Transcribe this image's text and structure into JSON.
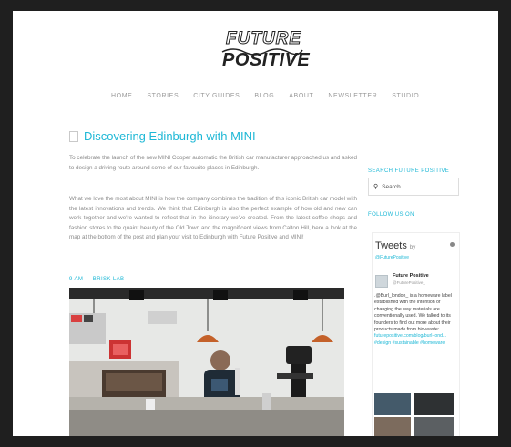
{
  "site": {
    "logo_line1": "FUTURE",
    "logo_line2": "POSITIVE"
  },
  "nav": [
    "HOME",
    "STORIES",
    "CITY GUIDES",
    "BLOG",
    "ABOUT",
    "NEWSLETTER",
    "STUDIO"
  ],
  "post": {
    "title": "Discovering Edinburgh with MINI",
    "para1": "To celebrate the launch of the new MINI Cooper automatic the British car manufacturer approached us and asked to design a driving route around some of our favourite places in Edinburgh.",
    "para2": "What we love the most about MINI is how the company combines the tradition of this iconic British car model with the latest innovations and trends. We think that Edinburgh is also the perfect example of how old and new can work together and we're wanted to reflect that in the itinerary we've created. From the latest coffee shops and fashion stores to the quaint beauty of the Old Town and the magnificent views from Calton Hill, here a look at the map at the bottom of the post and plan your visit to Edinburgh with Future Positive and MINI!",
    "meta": "9 AM — BRISK LAB"
  },
  "sidebar": {
    "search_label": "SEARCH FUTURE POSITIVE",
    "search_placeholder": "Search",
    "follow_label": "FOLLOW US ON",
    "tweets": {
      "title": "Tweets",
      "by": "by",
      "handle_line": "@FuturePositive_",
      "author_name": "Future Positive",
      "author_handle": "@FuturePositive_",
      "text": ".@Burl_london_ is a homeware label established with the intention of changing the way materials are conventionally used. We talked to its founders to find out more about their products made from bio-waste:",
      "link": "futurepositive.com/blog/burl-lond... #design #sustainable #homeware"
    }
  },
  "colors": {
    "accent": "#1fb8d6",
    "frame": "#1f1f1f"
  }
}
